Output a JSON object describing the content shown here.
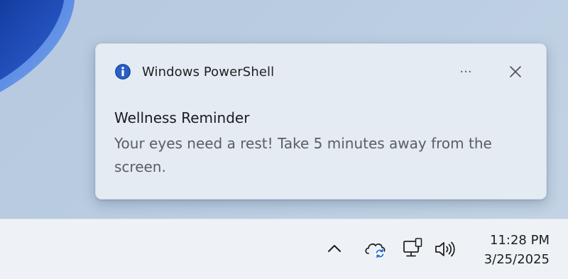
{
  "notification": {
    "app_name": "Windows PowerShell",
    "app_icon": "info-icon",
    "more_icon": "more-options-icon",
    "more_glyph": "···",
    "close_icon": "close-icon",
    "title": "Wellness Reminder",
    "message": "Your eyes need a rest! Take 5 minutes away from the screen."
  },
  "taskbar": {
    "tray_icons": [
      "chevron-up-icon",
      "onedrive-sync-icon",
      "network-icon",
      "volume-icon"
    ],
    "time": "11:28 PM",
    "date": "3/25/2025"
  },
  "colors": {
    "accent_blue": "#2b5fc4",
    "toast_background": "#e4ebf3",
    "taskbar_background": "#eef2f7"
  }
}
